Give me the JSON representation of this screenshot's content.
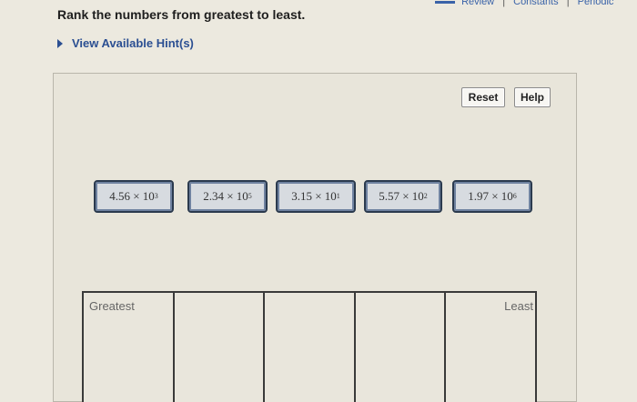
{
  "topbar": {
    "review": "Review",
    "constants": "Constants",
    "periodic": "Periodic"
  },
  "question": "Rank the numbers from greatest to least.",
  "hint_link": "View Available Hint(s)",
  "buttons": {
    "reset": "Reset",
    "help": "Help"
  },
  "tiles": [
    {
      "coef": "4.56",
      "exp": "3"
    },
    {
      "coef": "2.34",
      "exp": "5"
    },
    {
      "coef": "3.15",
      "exp": "1"
    },
    {
      "coef": "5.57",
      "exp": "2"
    },
    {
      "coef": "1.97",
      "exp": "6"
    }
  ],
  "times": "×",
  "base": "10",
  "slots": {
    "greatest_label": "Greatest",
    "least_label": "Least"
  }
}
